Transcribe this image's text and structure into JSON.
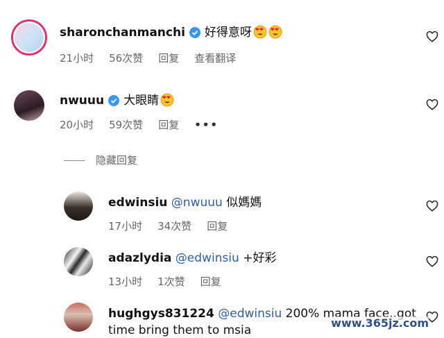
{
  "comments": [
    {
      "username": "sharonchanmanchi",
      "text": "好得意呀",
      "emoji_count": 2,
      "time": "21小时",
      "likes": "56次赞",
      "reply": "回复",
      "translate": "查看翻译"
    },
    {
      "username": "nwuuu",
      "text": "大眼睛",
      "emoji_count": 1,
      "time": "20小时",
      "likes": "59次赞",
      "reply": "回复",
      "more": "•••"
    }
  ],
  "hide_replies": "隐藏回复",
  "replies": [
    {
      "username": "edwinsiu",
      "mention": "@nwuuu",
      "text": "似媽媽",
      "time": "17小时",
      "likes": "34次赞",
      "reply": "回复"
    },
    {
      "username": "adazlydia",
      "mention": "@edwinsiu",
      "text": "+好彩",
      "time": "13小时",
      "likes": "1次赞",
      "reply": "回复"
    },
    {
      "username": "hughgys831224",
      "mention": "@edwinsiu",
      "text": "200% mama face..got",
      "text2": "time bring them to msia"
    }
  ],
  "watermark": "www.365jz.com",
  "colors": {
    "verified": "#3897f0",
    "mention": "#2b5ea8",
    "story_ring": "#e1306c"
  }
}
